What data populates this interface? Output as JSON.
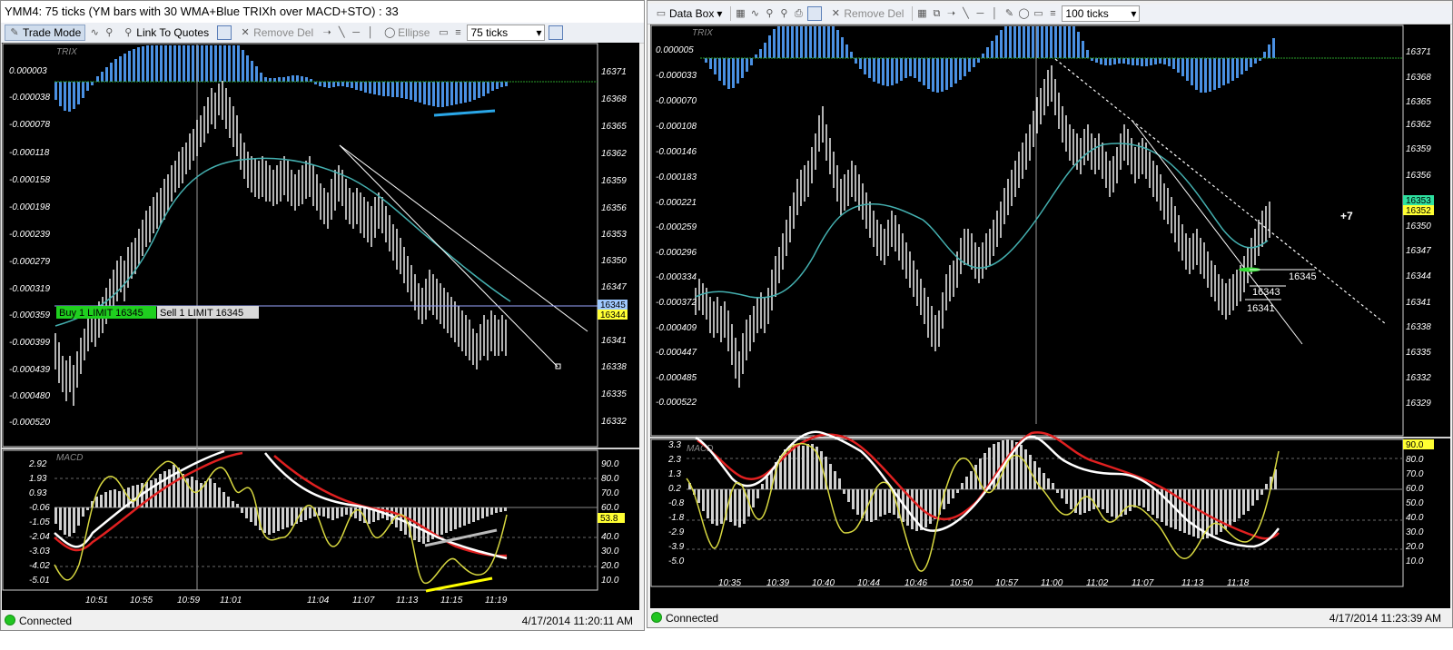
{
  "left": {
    "title": "YMM4: 75 ticks (YM bars with 30 WMA+Blue TRIXh over MACD+STO) : 33",
    "toolbar": {
      "trade_mode": "Trade Mode",
      "link_quotes": "Link To Quotes",
      "remove_del": "Remove Del",
      "ellipse": "Ellipse",
      "interval": "75 ticks"
    },
    "chart": {
      "trix_label": "TRIX",
      "macd_label": "MACD",
      "left_axis": [
        "0.000003",
        "-0.000038",
        "-0.000078",
        "-0.000118",
        "-0.000158",
        "-0.000198",
        "-0.000239",
        "-0.000279",
        "-0.000319",
        "-0.000359",
        "-0.000399",
        "-0.000439",
        "-0.000480",
        "-0.000520"
      ],
      "right_axis": [
        "16371",
        "16368",
        "16365",
        "16362",
        "16359",
        "16356",
        "16353",
        "16350",
        "16347",
        "16344",
        "16341",
        "16338",
        "16335",
        "16332"
      ],
      "price_tag_top": "16345",
      "price_tag_bottom": "16344",
      "buy_label": "Buy 1 LIMIT 16345",
      "sell_label": "Sell 1 LIMIT 16345",
      "macd_left_axis": [
        "2.92",
        "1.93",
        "0.93",
        "-0.06",
        "-1.05",
        "-2.04",
        "-3.03",
        "-4.02",
        "-5.01"
      ],
      "macd_right_axis": [
        "90.0",
        "80.0",
        "70.0",
        "60.0",
        "50.0",
        "40.0",
        "30.0",
        "20.0",
        "10.0"
      ],
      "sto_tag": "53.8",
      "time_axis": [
        "10:51",
        "10:55",
        "10:59",
        "11:01",
        "11:04",
        "11:07",
        "11:13",
        "11:15",
        "11:19"
      ]
    },
    "status": {
      "connected": "Connected",
      "time": "4/17/2014 11:20:11 AM"
    }
  },
  "right": {
    "toolbar": {
      "data_box": "Data Box",
      "remove_del": "Remove Del",
      "interval": "100 ticks"
    },
    "chart": {
      "trix_label": "TRIX",
      "macd_label": "MACD",
      "left_axis": [
        "0.000005",
        "-0.000033",
        "-0.000070",
        "-0.000108",
        "-0.000146",
        "-0.000183",
        "-0.000221",
        "-0.000259",
        "-0.000296",
        "-0.000334",
        "-0.000372",
        "-0.000409",
        "-0.000447",
        "-0.000485",
        "-0.000522"
      ],
      "right_axis": [
        "16371",
        "16368",
        "16365",
        "16362",
        "16359",
        "16356",
        "16353",
        "16350",
        "16347",
        "16344",
        "16341",
        "16338",
        "16335",
        "16332",
        "16329"
      ],
      "price_tag_top": "16353",
      "price_tag_bottom": "16352",
      "plus_label": "+7",
      "annotation_1": "16345",
      "annotation_2": "16343",
      "annotation_3": "16341",
      "macd_left_axis": [
        "3.3",
        "2.3",
        "1.3",
        "0.2",
        "-0.8",
        "-1.8",
        "-2.9",
        "-3.9",
        "-5.0"
      ],
      "macd_right_axis": [
        "90.0",
        "80.0",
        "70.0",
        "60.0",
        "50.0",
        "40.0",
        "30.0",
        "20.0",
        "10.0"
      ],
      "sto_tag": "90.0",
      "time_axis": [
        "10:35",
        "10:39",
        "10:40",
        "10:44",
        "10:46",
        "10:50",
        "10:57",
        "11:00",
        "11:02",
        "11:07",
        "11:13",
        "11:18"
      ]
    },
    "status": {
      "connected": "Connected",
      "time": "4/17/2014 11:23:39 AM"
    }
  }
}
